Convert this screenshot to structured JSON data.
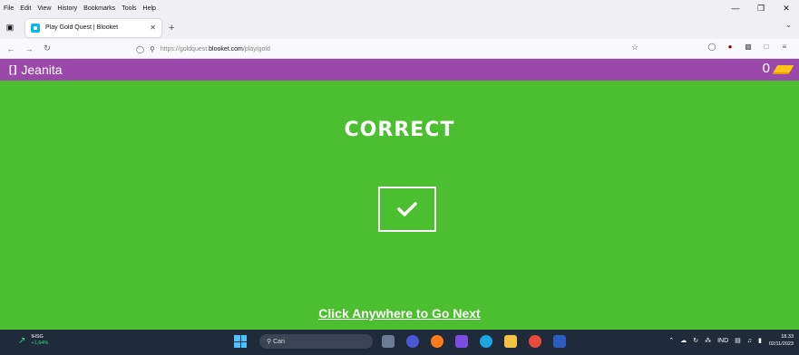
{
  "menubar": {
    "items": [
      "File",
      "Edit",
      "View",
      "History",
      "Bookmarks",
      "Tools",
      "Help"
    ]
  },
  "tab": {
    "title": "Play Gold Quest | Blooket"
  },
  "navbar": {
    "url_prefix": "https://goldquest.",
    "url_domain": "blooket.com",
    "url_path": "/play/gold"
  },
  "game": {
    "player_name": "Jeanita",
    "gold_count": "0",
    "result_text": "CORRECT",
    "next_text": "Click Anywhere to Go Next"
  },
  "taskbar": {
    "stock_name": "IHSG",
    "stock_change": "+1,64%",
    "search_label": "Cari",
    "language": "IND",
    "time": "18.33",
    "date": "02/11/2023"
  },
  "colors": {
    "game_bg": "#4bbf2f",
    "header_bg": "#9a49aa",
    "gold": "#ffc21a",
    "taskbar_bg": "#1f2a3a"
  }
}
